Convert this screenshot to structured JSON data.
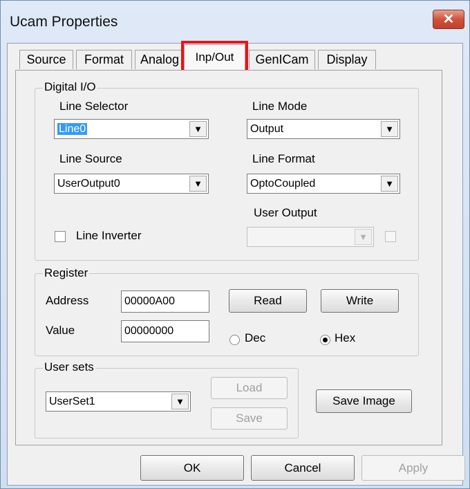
{
  "window": {
    "title": "Ucam Properties",
    "close_glyph": "✕"
  },
  "tabs": [
    {
      "label": "Source",
      "active": false
    },
    {
      "label": "Format",
      "active": false
    },
    {
      "label": "Analog",
      "active": false
    },
    {
      "label": "Inp/Out",
      "active": true
    },
    {
      "label": "GenICam",
      "active": false
    },
    {
      "label": "Display",
      "active": false
    }
  ],
  "digital_io": {
    "legend": "Digital I/O",
    "line_selector": {
      "label": "Line Selector",
      "value": "Line0"
    },
    "line_mode": {
      "label": "Line Mode",
      "value": "Output"
    },
    "line_source": {
      "label": "Line Source",
      "value": "UserOutput0"
    },
    "line_format": {
      "label": "Line Format",
      "value": "OptoCoupled"
    },
    "user_output": {
      "label": "User Output",
      "value": ""
    },
    "line_inverter": {
      "label": "Line Inverter",
      "checked": false
    }
  },
  "register": {
    "legend": "Register",
    "address_label": "Address",
    "address_value": "00000A00",
    "value_label": "Value",
    "value_value": "00000000",
    "read_label": "Read",
    "write_label": "Write",
    "dec_label": "Dec",
    "hex_label": "Hex",
    "selected_base": "Hex"
  },
  "user_sets": {
    "legend": "User sets",
    "selected": "UserSet1",
    "load_label": "Load",
    "save_label": "Save"
  },
  "save_image_label": "Save Image",
  "footer": {
    "ok_label": "OK",
    "cancel_label": "Cancel",
    "apply_label": "Apply"
  },
  "icons": {
    "dropdown_arrow": "▼"
  },
  "colors": {
    "highlight_box": "#e8141c",
    "selection": "#3399ff",
    "close_button": "#c94a33"
  }
}
